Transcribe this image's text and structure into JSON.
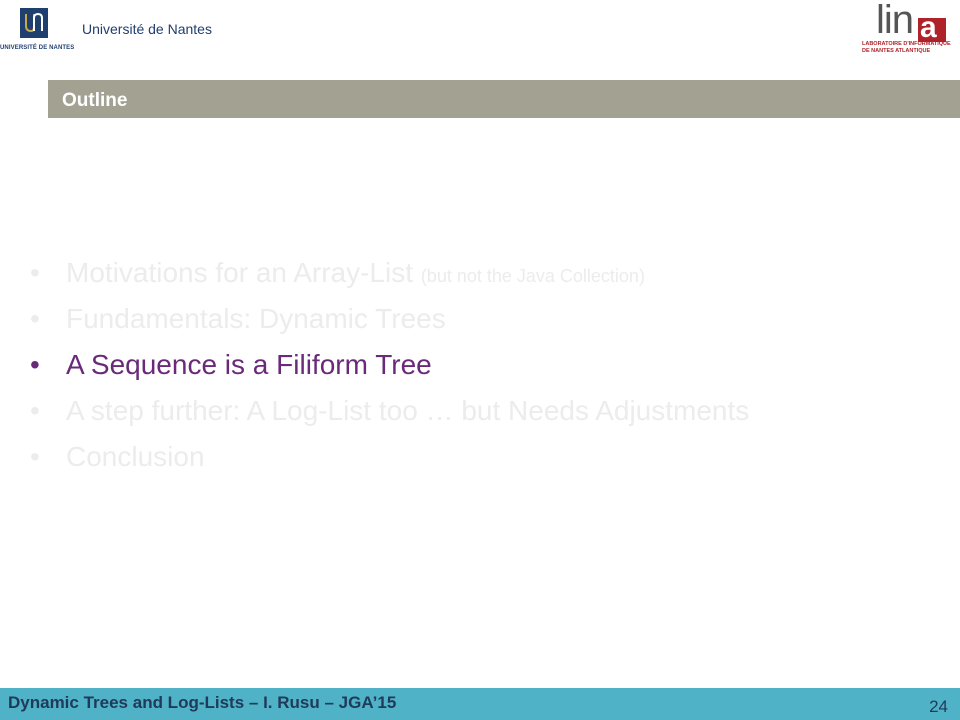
{
  "header": {
    "university_logo_caption": "UNIVERSITÉ DE NANTES",
    "university_name": "Université de Nantes",
    "lab_logo_word": "lin",
    "lab_logo_letter": "a",
    "lab_logo_tagline_1": "LABORATOIRE D'INFORMATIQUE",
    "lab_logo_tagline_2": "DE NANTES ATLANTIQUE"
  },
  "slide": {
    "title": "Outline",
    "items": [
      {
        "bullet": "•",
        "text": "Motivations for an Array-List ",
        "note": "(but not the Java Collection)",
        "state": "dim"
      },
      {
        "bullet": "•",
        "text": "Fundamentals: Dynamic Trees",
        "note": "",
        "state": "dim"
      },
      {
        "bullet": "•",
        "text": "A Sequence is a Filiform Tree",
        "note": "",
        "state": "active"
      },
      {
        "bullet": "•",
        "text": "A step further: A Log-List too … but Needs Adjustments",
        "note": "",
        "state": "dim"
      },
      {
        "bullet": "•",
        "text": "Conclusion",
        "note": "",
        "state": "dim"
      }
    ]
  },
  "footer": {
    "title": "Dynamic Trees and Log-Lists – I. Rusu – JGA’15",
    "page_number": "24"
  },
  "colors": {
    "title_bar": "#a3a192",
    "footer_bar": "#4fb2c6",
    "active_item": "#6a2a7a",
    "dim_item": "#ececec",
    "university_blue": "#1f3f6e",
    "lab_red": "#b0222a"
  }
}
